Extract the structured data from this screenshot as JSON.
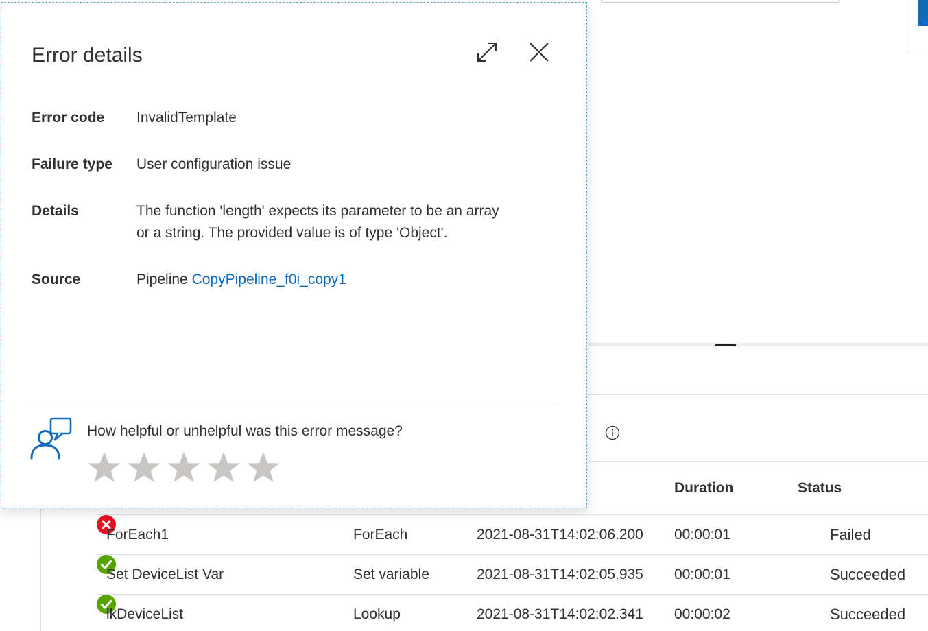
{
  "panel": {
    "title": "Error details",
    "expand_icon": "expand-icon",
    "close_icon": "close-icon",
    "fields": [
      {
        "label": "Error code",
        "value": "InvalidTemplate"
      },
      {
        "label": "Failure type",
        "value": "User configuration issue"
      },
      {
        "label": "Details",
        "value_line1": "The function 'length' expects its parameter to be an array",
        "value_line2": "or a string. The provided value is of type 'Object'."
      },
      {
        "label": "Source",
        "value_prefix": "Pipeline",
        "link": "CopyPipeline_f0i_copy1"
      }
    ],
    "feedback": {
      "icon": "feedback-person-icon",
      "question": "How helpful or unhelpful was this error message?",
      "rating": 0,
      "max_rating": 5,
      "star_color": "#c8c6c4"
    }
  },
  "runs_table": {
    "headers": {
      "duration": "Duration",
      "status": "Status"
    },
    "rows": [
      {
        "name": "ForEach1",
        "type": "ForEach",
        "start": "2021-08-31T14:02:06.200",
        "duration": "00:00:01",
        "status": "Failed",
        "status_icon": "error-circle-icon",
        "status_color": "#e81123"
      },
      {
        "name": "Set DeviceList Var",
        "type": "Set variable",
        "start": "2021-08-31T14:02:05.935",
        "duration": "00:00:01",
        "status": "Succeeded",
        "status_icon": "success-check-icon",
        "status_color": "#57a300"
      },
      {
        "name": "lkDeviceList",
        "type": "Lookup",
        "start": "2021-08-31T14:02:02.341",
        "duration": "00:00:02",
        "status": "Succeeded",
        "status_icon": "success-check-icon",
        "status_color": "#57a300"
      }
    ]
  },
  "colors": {
    "link": "#0f6cbd",
    "accent": "#0f6cbd",
    "failed": "#e81123",
    "succeeded": "#57a300"
  }
}
